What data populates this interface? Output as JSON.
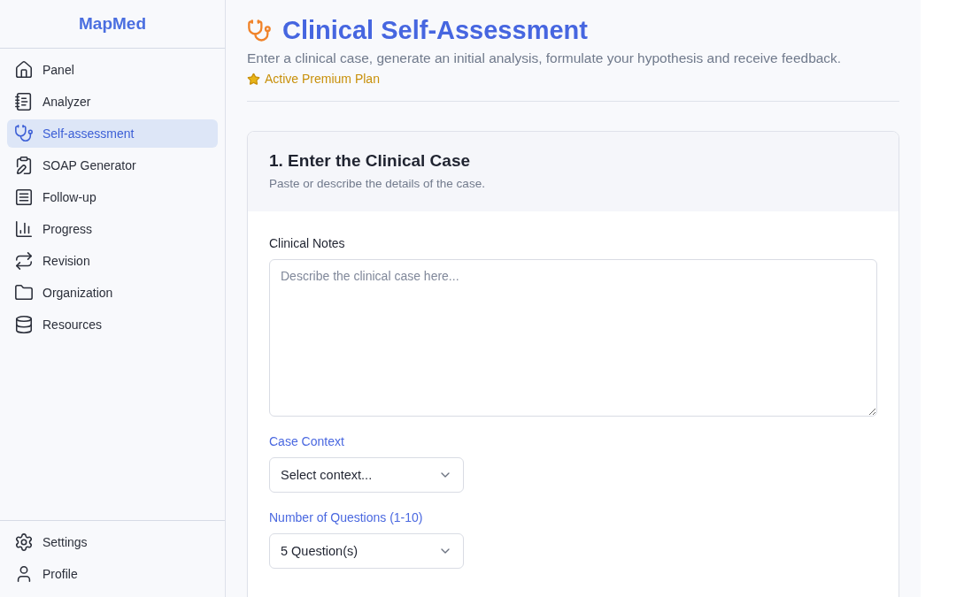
{
  "sidebar": {
    "brand": "MapMed",
    "items": [
      {
        "label": "Panel",
        "selected": false
      },
      {
        "label": "Analyzer",
        "selected": false
      },
      {
        "label": "Self-assessment",
        "selected": true
      },
      {
        "label": "SOAP Generator",
        "selected": false
      },
      {
        "label": "Follow-up",
        "selected": false
      },
      {
        "label": "Progress",
        "selected": false
      },
      {
        "label": "Revision",
        "selected": false
      },
      {
        "label": "Organization",
        "selected": false
      },
      {
        "label": "Resources",
        "selected": false
      }
    ],
    "footer_items": [
      {
        "label": "Settings",
        "selected": false
      },
      {
        "label": "Profile",
        "selected": false
      }
    ]
  },
  "header": {
    "title": "Clinical Self-Assessment",
    "subtitle": "Enter a clinical case, generate an initial analysis, formulate your hypothesis and receive feedback.",
    "plan_badge": "Active Premium Plan"
  },
  "card": {
    "title": "1. Enter the Clinical Case",
    "subtitle": "Paste or describe the details of the case.",
    "notes_label": "Clinical Notes",
    "notes_placeholder": "Describe the clinical case here...",
    "selects": [
      {
        "label": "Case Context",
        "value": "Select context..."
      },
      {
        "label": "Number of Questions (1-10)",
        "value": "5 Question(s)"
      }
    ]
  }
}
